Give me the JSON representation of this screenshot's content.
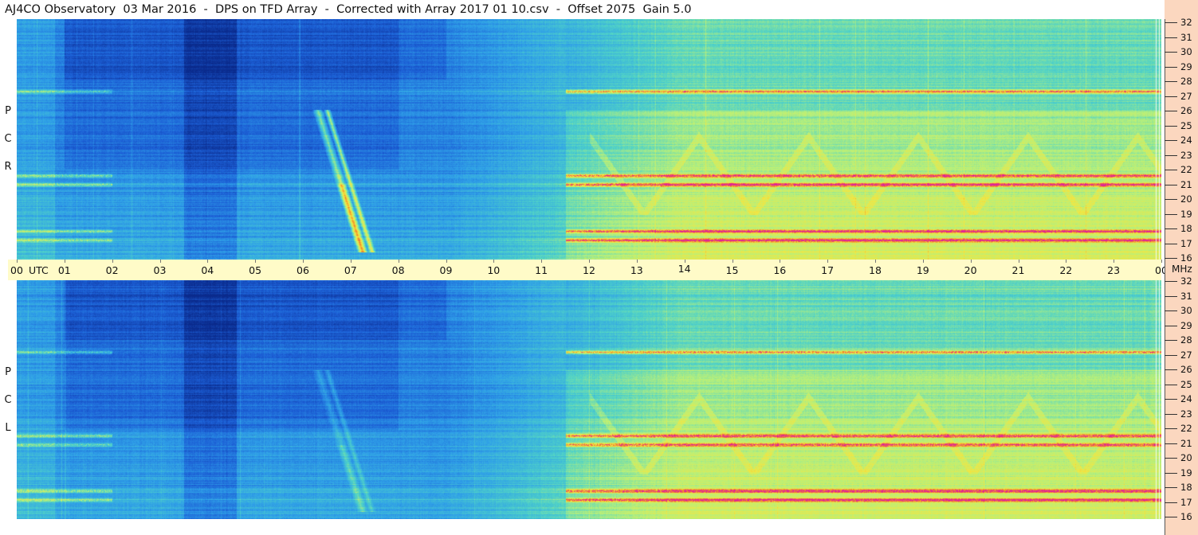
{
  "header": {
    "title": "AJ4CO Observatory  03 Mar 2016  -  DPS on TFD Array  -  Corrected with Array 2017 01 10.csv  -  Offset 2075  Gain 5.0"
  },
  "panels": {
    "top": {
      "polarization_letters": [
        "R",
        "C",
        "P"
      ]
    },
    "bottom": {
      "polarization_letters": [
        "L",
        "C",
        "P"
      ]
    }
  },
  "chart_data": {
    "type": "heatmap",
    "title": "AJ4CO Observatory  03 Mar 2016  -  DPS on TFD Array  -  Corrected with Array 2017 01 10.csv  -  Offset 2075  Gain 5.0",
    "xlabel": "UTC",
    "ylabel": "MHz",
    "x_ticks": [
      "00",
      "01",
      "02",
      "03",
      "04",
      "05",
      "06",
      "07",
      "08",
      "09",
      "10",
      "11",
      "12",
      "13",
      "14",
      "15",
      "16",
      "17",
      "18",
      "19",
      "20",
      "21",
      "22",
      "23",
      "00"
    ],
    "x_unit_label": "UTC",
    "y_unit_label": "MHz",
    "xlim_hours_utc": [
      0,
      24
    ],
    "ylim_mhz": [
      16,
      32
    ],
    "y_ticks": [
      "16",
      "17",
      "18",
      "19",
      "20",
      "21",
      "22",
      "23",
      "24",
      "25",
      "26",
      "27",
      "28",
      "29",
      "30",
      "31",
      "32"
    ],
    "series": [
      {
        "name": "RCP",
        "panel": "top"
      },
      {
        "name": "LCP",
        "panel": "bottom"
      }
    ],
    "colormap": [
      "#0a2a8c",
      "#1c5fd6",
      "#2fa0e8",
      "#4fd2c8",
      "#b8f07a",
      "#f4e640",
      "#f08a2a",
      "#e0209a"
    ],
    "features": {
      "strong_bands_mhz": [
        17.3,
        17.9,
        21.0,
        21.6,
        27.2
      ],
      "dark_interval_utc": [
        3.5,
        4.6
      ],
      "sweep_burst_utc": [
        6.3,
        7.3
      ],
      "daytime_rise_utc": [
        11.5,
        24
      ]
    }
  }
}
